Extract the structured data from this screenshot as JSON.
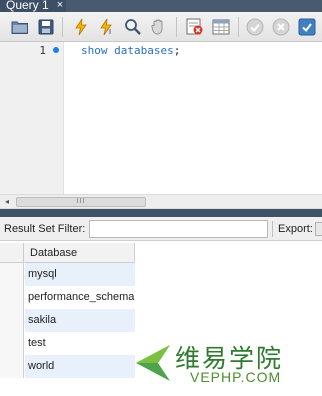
{
  "tab": {
    "title": "Query 1",
    "close": "×"
  },
  "toolbar": {
    "buttons": [
      {
        "icon": "open-file-icon"
      },
      {
        "icon": "save-icon"
      },
      {
        "icon": "execute-lightning-icon"
      },
      {
        "icon": "execute-current-icon"
      },
      {
        "icon": "explain-magnifier-icon"
      },
      {
        "icon": "stop-hand-icon"
      },
      {
        "icon": "toggle-stop-on-error-icon"
      },
      {
        "icon": "toggle-result-grid-icon"
      },
      {
        "icon": "commit-check-icon"
      },
      {
        "icon": "rollback-cancel-icon"
      },
      {
        "icon": "autocommit-toggle-icon"
      }
    ]
  },
  "editor": {
    "line_number": "1",
    "code_keyword": "show databases",
    "code_terminator": ";"
  },
  "hscroll": {
    "left_arrow": "◂",
    "thumb_grip": "III"
  },
  "filter": {
    "label": "Result Set Filter:",
    "value": "",
    "export_label": "Export:"
  },
  "grid": {
    "column": "Database",
    "rows": [
      "mysql",
      "performance_schema",
      "sakila",
      "test",
      "world"
    ]
  },
  "watermark": {
    "cn": "维易学院",
    "en": "VEPHP.COM"
  },
  "colors": {
    "tab_bar": "#4a5a6e",
    "keyword": "#2a6fcf",
    "row_highlight": "#e8f0fb",
    "watermark": "#2e7a2e"
  }
}
